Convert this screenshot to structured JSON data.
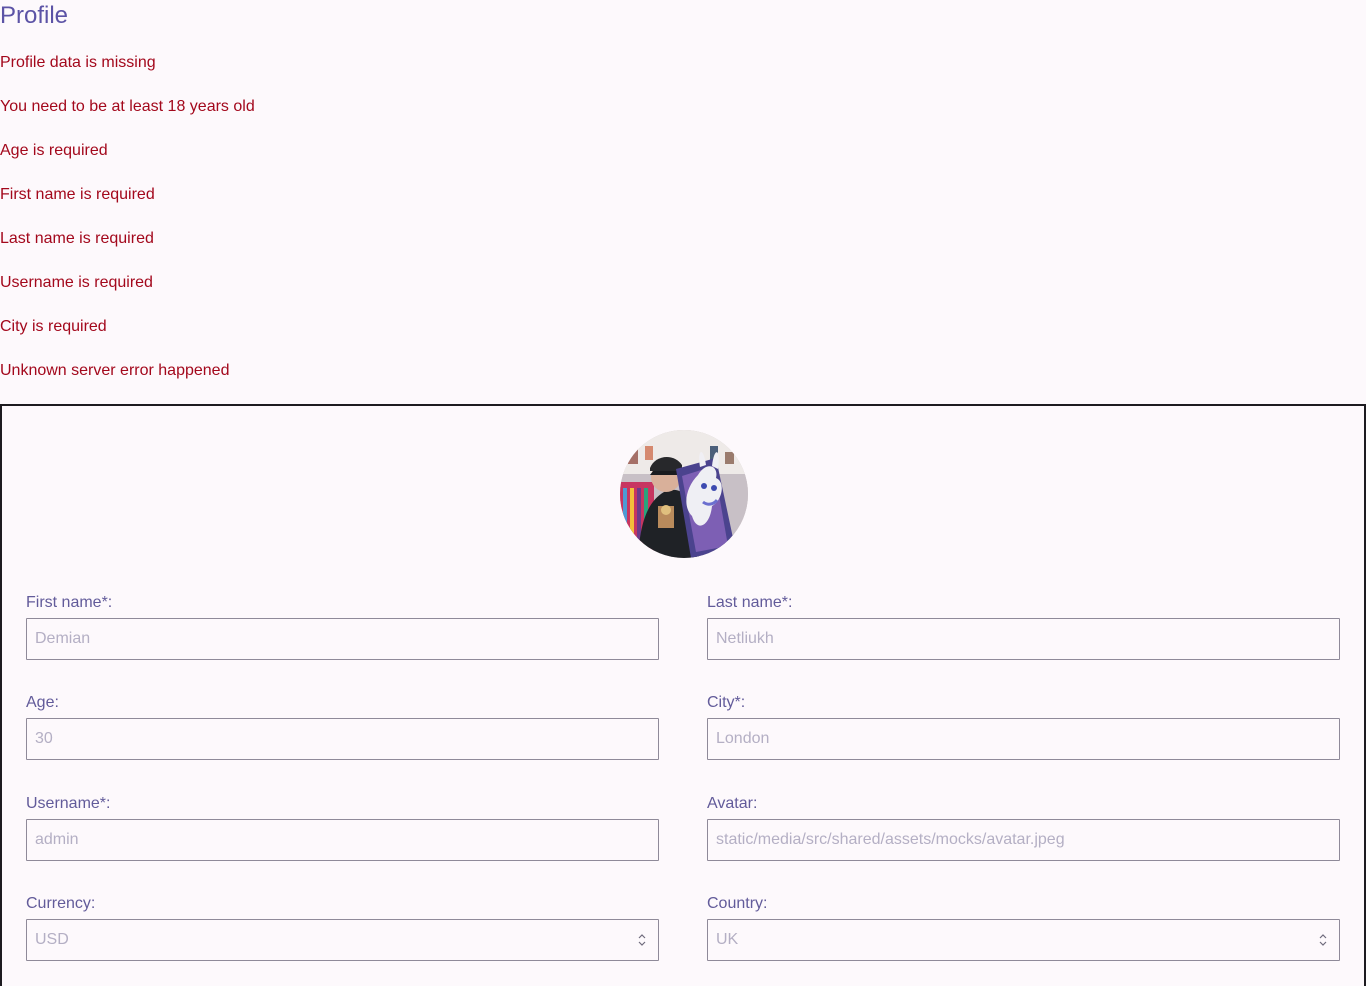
{
  "page": {
    "title": "Profile"
  },
  "errors": [
    "Profile data is missing",
    "You need to be at least 18 years old",
    "Age is required",
    "First name is required",
    "Last name is required",
    "Username is required",
    "City is required",
    "Unknown server error happened"
  ],
  "profile": {
    "avatar_icon": "user-avatar-photo",
    "first_name": {
      "label": "First name*:",
      "placeholder": "Demian"
    },
    "last_name": {
      "label": "Last name*:",
      "placeholder": "Netliukh"
    },
    "age": {
      "label": "Age:",
      "placeholder": "30"
    },
    "city": {
      "label": "City*:",
      "placeholder": "London"
    },
    "username": {
      "label": "Username*:",
      "placeholder": "admin"
    },
    "avatar": {
      "label": "Avatar:",
      "placeholder": "static/media/src/shared/assets/mocks/avatar.jpeg"
    },
    "currency": {
      "label": "Currency:",
      "value": "USD"
    },
    "country": {
      "label": "Country:",
      "value": "UK"
    }
  },
  "colors": {
    "title": "#5c53a6",
    "error": "#a3081c",
    "label": "#625b9a",
    "placeholder": "#b4afc4",
    "border": "#8f8a99",
    "background": "#fdf9fc"
  }
}
